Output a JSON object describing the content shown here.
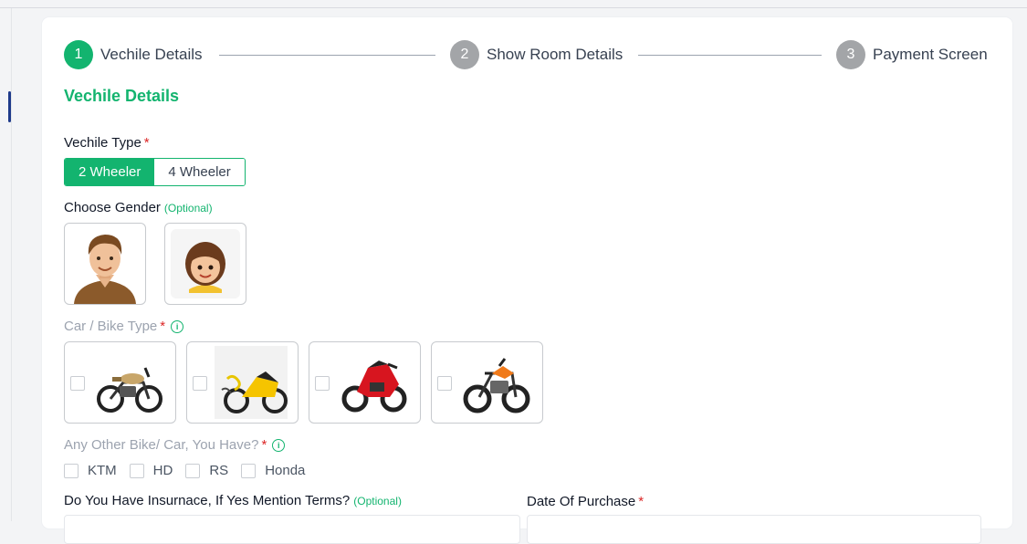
{
  "stepper": {
    "steps": [
      {
        "number": "1",
        "label": "Vechile Details",
        "state": "active"
      },
      {
        "number": "2",
        "label": "Show Room Details",
        "state": "idle"
      },
      {
        "number": "3",
        "label": "Payment Screen",
        "state": "idle"
      }
    ]
  },
  "form": {
    "section_title": "Vechile Details",
    "vehicle_type": {
      "label": "Vechile Type",
      "required_mark": "*",
      "options": [
        "2 Wheeler",
        "4 Wheeler"
      ],
      "selected": "2 Wheeler"
    },
    "gender": {
      "label": "Choose Gender",
      "optional": "(Optional)",
      "options": [
        "male-avatar",
        "female-avatar"
      ]
    },
    "bike_type": {
      "label": "Car / Bike Type",
      "required_mark": "*",
      "info_icon": "i",
      "options": [
        "classic-cruiser-bike",
        "yellow-sport-bike",
        "red-sport-bike",
        "naked-street-bike"
      ]
    },
    "other_vehicle": {
      "label": "Any Other Bike/ Car, You Have?",
      "required_mark": "*",
      "info_icon": "i",
      "options": [
        "KTM",
        "HD",
        "RS",
        "Honda"
      ]
    },
    "insurance": {
      "label": "Do You Have Insurnace, If Yes Mention Terms?",
      "optional": "(Optional)"
    },
    "purchase_date": {
      "label": "Date Of Purchase",
      "required_mark": "*"
    }
  },
  "colors": {
    "accent": "#13b46f",
    "required": "#dc2626",
    "step_idle": "#a3a5a8"
  }
}
